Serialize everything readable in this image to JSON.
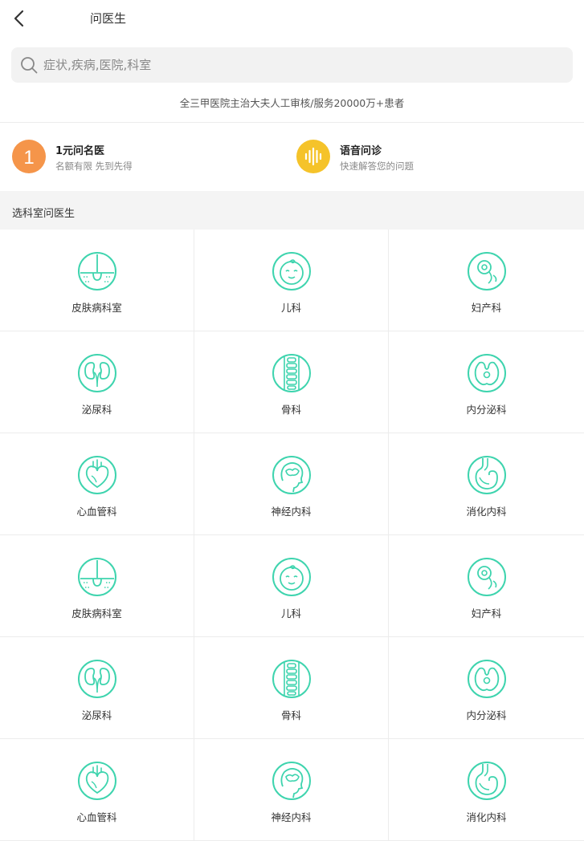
{
  "header": {
    "title": "问医生"
  },
  "search": {
    "placeholder": "症状,疾病,医院,科室",
    "value": ""
  },
  "subtitle": "全三甲医院主治大夫人工审核/服务20000万+患者",
  "promos": [
    {
      "badge": "1",
      "title": "1元问名医",
      "desc": "名额有限 先到先得",
      "color": "#f5954a",
      "icon": "number-one-badge"
    },
    {
      "title": "语音问诊",
      "desc": "快速解答您的问题",
      "color": "#f5c32a",
      "icon": "voice-wave-icon"
    }
  ],
  "section": {
    "title": "选科室问医生"
  },
  "accent_color": "#3ed4ae",
  "departments": [
    {
      "label": "皮肤病科室",
      "icon": "skin-icon"
    },
    {
      "label": "儿科",
      "icon": "baby-icon"
    },
    {
      "label": "妇产科",
      "icon": "fetus-icon"
    },
    {
      "label": "泌尿科",
      "icon": "kidney-icon"
    },
    {
      "label": "骨科",
      "icon": "spine-icon"
    },
    {
      "label": "内分泌科",
      "icon": "endocrine-icon"
    },
    {
      "label": "心血管科",
      "icon": "heart-icon"
    },
    {
      "label": "神经内科",
      "icon": "brain-icon"
    },
    {
      "label": "消化内科",
      "icon": "stomach-icon"
    },
    {
      "label": "皮肤病科室",
      "icon": "skin-icon"
    },
    {
      "label": "儿科",
      "icon": "baby-icon"
    },
    {
      "label": "妇产科",
      "icon": "fetus-icon"
    },
    {
      "label": "泌尿科",
      "icon": "kidney-icon"
    },
    {
      "label": "骨科",
      "icon": "spine-icon"
    },
    {
      "label": "内分泌科",
      "icon": "endocrine-icon"
    },
    {
      "label": "心血管科",
      "icon": "heart-icon"
    },
    {
      "label": "神经内科",
      "icon": "brain-icon"
    },
    {
      "label": "消化内科",
      "icon": "stomach-icon"
    }
  ]
}
